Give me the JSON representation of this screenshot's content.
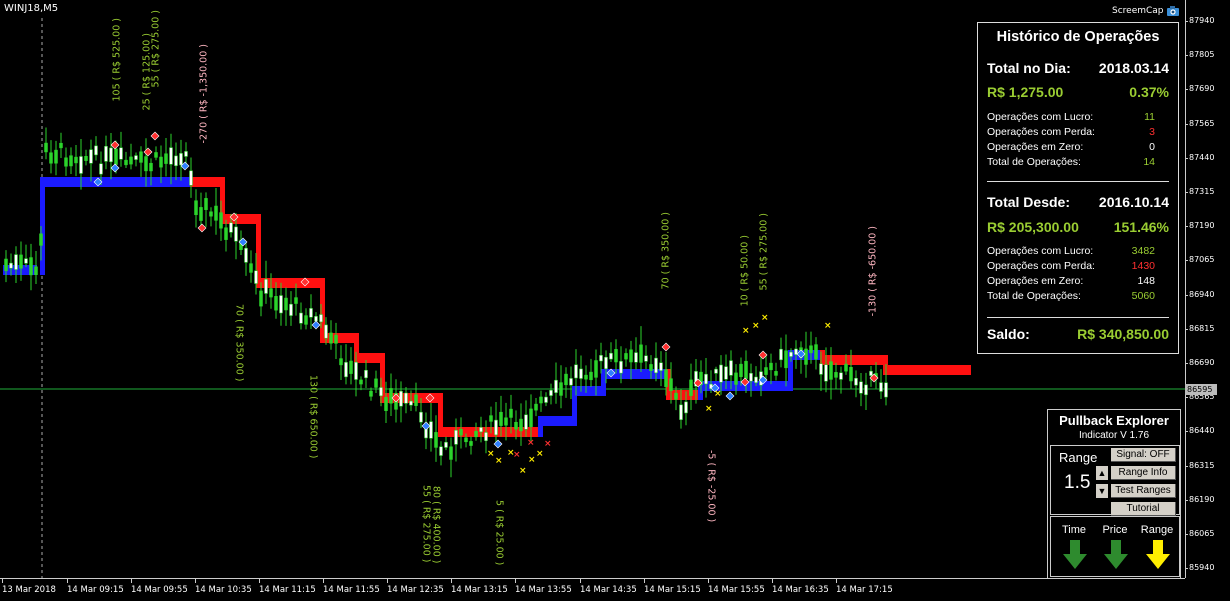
{
  "symbol": "WINJ18,M5",
  "screencam": "ScreemCap",
  "price_axis": [
    "87940",
    "87805",
    "87690",
    "87565",
    "87440",
    "87315",
    "87190",
    "87065",
    "86940",
    "86815",
    "86690",
    "86565",
    "86440",
    "86315",
    "86190",
    "86065",
    "85940"
  ],
  "current_price": "86595",
  "time_axis": [
    "13 Mar 2018",
    "14 Mar 09:15",
    "14 Mar 09:55",
    "14 Mar 10:35",
    "14 Mar 11:15",
    "14 Mar 11:55",
    "14 Mar 12:35",
    "14 Mar 13:15",
    "14 Mar 13:55",
    "14 Mar 14:35",
    "14 Mar 15:15",
    "14 Mar 15:55",
    "14 Mar 16:35",
    "14 Mar 17:15"
  ],
  "annotations": [
    {
      "text": "105 ( R$ 525.00 )",
      "color": "#9acd32"
    },
    {
      "text": "25 ( R$ 125.00 )",
      "color": "#9acd32"
    },
    {
      "text": "55 ( R$ 275.00 )",
      "color": "#9acd32"
    },
    {
      "text": "-270 ( R$ -1,350.00 )",
      "color": "#ffb6c1"
    },
    {
      "text": "70 ( R$ 350.00 )",
      "color": "#9acd32"
    },
    {
      "text": "130 ( R$ 650.00 )",
      "color": "#9acd32"
    },
    {
      "text": "80 ( R$ 400.00 )",
      "color": "#9acd32"
    },
    {
      "text": "55 ( R$ 275.00 )",
      "color": "#9acd32"
    },
    {
      "text": "5 ( R$ 25.00 )",
      "color": "#9acd32"
    },
    {
      "text": "-5 ( R$ -25.00 )",
      "color": "#ffb6c1"
    },
    {
      "text": "70 ( R$ 350.00 )",
      "color": "#9acd32"
    },
    {
      "text": "10 ( R$ 50.00 )",
      "color": "#9acd32"
    },
    {
      "text": "55 ( R$ 275.00 )",
      "color": "#9acd32"
    },
    {
      "text": "-130 ( R$ -650.00 )",
      "color": "#ffb6c1"
    }
  ],
  "history": {
    "title": "Histórico de Operações",
    "day_label": "Total no Dia:",
    "day_date": "2018.03.14",
    "day_money": "R$ 1,275.00",
    "day_pct": "0.37%",
    "day_rows": [
      {
        "label": "Operações com Lucro:",
        "value": "11",
        "color": "#9acd32"
      },
      {
        "label": "Operações com Perda:",
        "value": "3",
        "color": "#ff3030"
      },
      {
        "label": "Operações em Zero:",
        "value": "0",
        "color": "#ffffff"
      },
      {
        "label": "Total de Operações:",
        "value": "14",
        "color": "#9acd32"
      }
    ],
    "since_label": "Total Desde:",
    "since_date": "2016.10.14",
    "since_money": "R$ 205,300.00",
    "since_pct": "151.46%",
    "since_rows": [
      {
        "label": "Operações com Lucro:",
        "value": "3482",
        "color": "#9acd32"
      },
      {
        "label": "Operações com Perda:",
        "value": "1430",
        "color": "#ff3030"
      },
      {
        "label": "Operações em Zero:",
        "value": "148",
        "color": "#ffffff"
      },
      {
        "label": "Total de Operações:",
        "value": "5060",
        "color": "#9acd32"
      }
    ],
    "saldo_label": "Saldo:",
    "saldo_value": "R$ 340,850.00"
  },
  "pullback": {
    "name": "Pullback Explorer",
    "version": "Indicator V 1.76",
    "range_label": "Range",
    "range_value": "1.5",
    "buttons": [
      "Signal: OFF",
      "Range Info",
      "Test Ranges",
      "Tutorial"
    ],
    "captions": [
      "Time",
      "Price",
      "Range"
    ],
    "arrow_colors": [
      "#2e8b2e",
      "#2e8b2e",
      "#ffee00"
    ]
  }
}
